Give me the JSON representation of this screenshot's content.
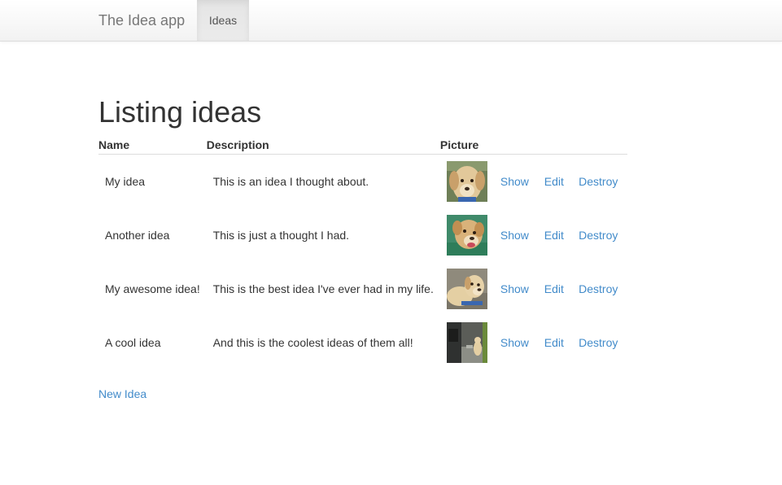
{
  "navbar": {
    "brand": "The Idea app",
    "items": [
      {
        "label": "Ideas",
        "active": true
      }
    ]
  },
  "page": {
    "title": "Listing ideas",
    "new_link": "New Idea"
  },
  "table": {
    "headers": [
      "Name",
      "Description",
      "Picture"
    ],
    "rows": [
      {
        "name": "My idea",
        "description": "This is an idea I thought about.",
        "picture": "dog-photo-1"
      },
      {
        "name": "Another idea",
        "description": "This is just a thought I had.",
        "picture": "dog-photo-2"
      },
      {
        "name": "My awesome idea!",
        "description": "This is the best idea I've ever had in my life.",
        "picture": "dog-photo-3"
      },
      {
        "name": "A cool idea",
        "description": "And this is the coolest ideas of them all!",
        "picture": "dog-photo-4"
      }
    ],
    "actions": {
      "show": "Show",
      "edit": "Edit",
      "destroy": "Destroy"
    }
  },
  "colors": {
    "link": "#428bca",
    "text": "#333333",
    "brand": "#777777"
  }
}
